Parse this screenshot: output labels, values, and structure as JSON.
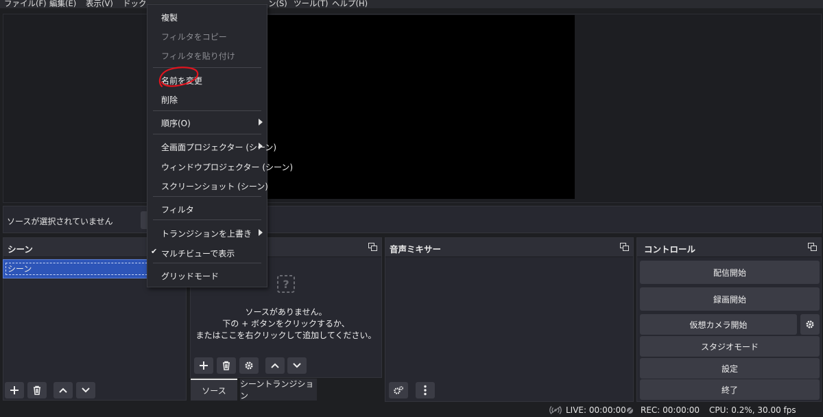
{
  "menubar": [
    "ファイル(F)",
    "編集(E)",
    "表示(V)",
    "ドック(D",
    "ン(S)",
    "ツール(T)",
    "ヘルプ(H)"
  ],
  "source_status": {
    "text": "ソースが選択されていません"
  },
  "scenes_dock": {
    "title": "シーン",
    "items": [
      "シーン"
    ]
  },
  "sources_dock": {
    "empty_title": "ソースがありません。",
    "empty_line2": "下の + ボタンをクリックするか、",
    "empty_line3": "またはここを右クリックして追加してください。",
    "tabs": [
      "ソース",
      "シーントランジション"
    ]
  },
  "mixer_dock": {
    "title": "音声ミキサー"
  },
  "controls_dock": {
    "title": "コントロール",
    "buttons": [
      "配信開始",
      "録画開始",
      "仮想カメラ開始",
      "スタジオモード",
      "設定",
      "終了"
    ]
  },
  "statusbar": {
    "live": "LIVE: 00:00:00",
    "rec": "REC: 00:00:00",
    "cpu": "CPU: 0.2%, 30.00 fps"
  },
  "context_menu": {
    "items": [
      {
        "label": "複製",
        "enabled": true
      },
      {
        "label": "フィルタをコピー",
        "enabled": false
      },
      {
        "label": "フィルタを貼り付け",
        "enabled": false
      },
      {
        "label": "名前を変更",
        "enabled": true,
        "highlighted_with_red_circle": true
      },
      {
        "label": "削除",
        "enabled": true
      },
      {
        "label": "順序(O)",
        "enabled": true,
        "submenu": true
      },
      {
        "label": "全画面プロジェクター (シーン)",
        "enabled": true,
        "submenu": true
      },
      {
        "label": "ウィンドウプロジェクター (シーン)",
        "enabled": true
      },
      {
        "label": "スクリーンショット (シーン)",
        "enabled": true
      },
      {
        "label": "フィルタ",
        "enabled": true
      },
      {
        "label": "トランジションを上書き",
        "enabled": true,
        "submenu": true
      },
      {
        "label": "マルチビューで表示",
        "enabled": true,
        "checked": true
      },
      {
        "label": "グリッドモード",
        "enabled": true
      }
    ]
  },
  "colors": {
    "accent": "#2d55b8",
    "annotation": "#e0141e"
  }
}
